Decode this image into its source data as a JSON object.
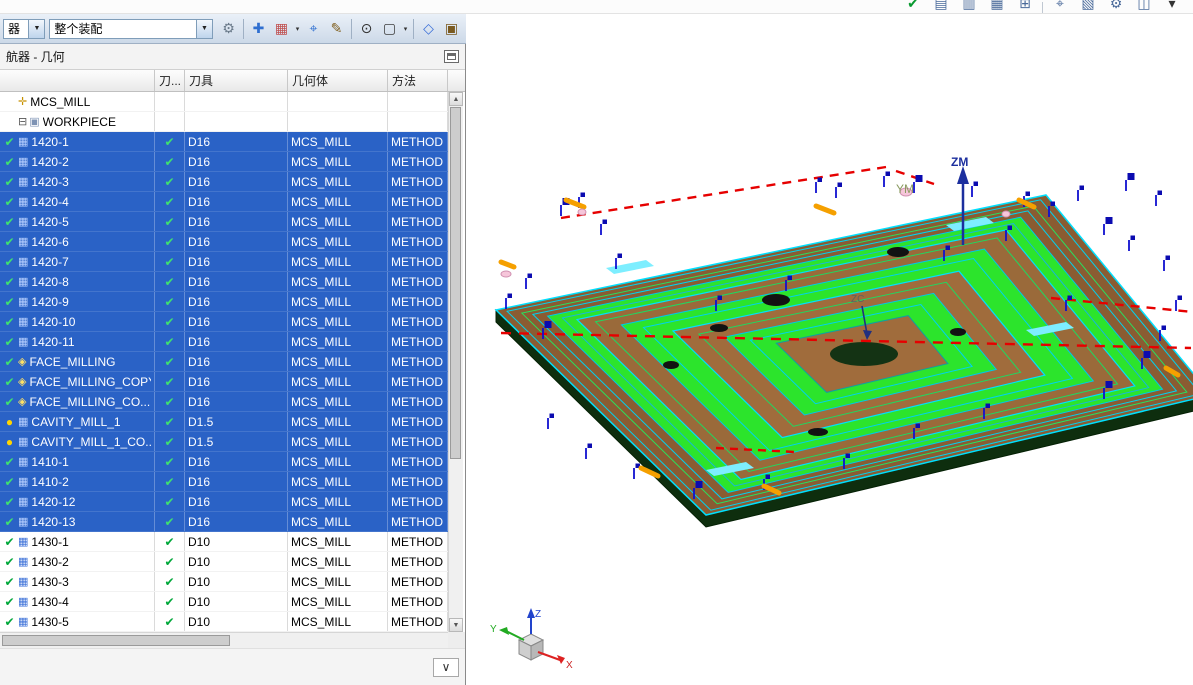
{
  "top_strip": {
    "icons": [
      {
        "name": "finish-icon",
        "glyph": "✔",
        "color": "#0a9a30"
      },
      {
        "name": "maximize-window-icon",
        "glyph": "▤",
        "color": "#4a6a9a"
      },
      {
        "name": "split-view-icon",
        "glyph": "▥",
        "color": "#4a6a9a"
      },
      {
        "name": "window-layout-icon",
        "glyph": "▦",
        "color": "#4a6a9a"
      },
      {
        "name": "new-window-icon",
        "glyph": "⊞",
        "color": "#4a6a9a"
      },
      {
        "sep": true
      },
      {
        "name": "select-filter-icon",
        "glyph": "⌖",
        "color": "#4a6a9a"
      },
      {
        "name": "information-icon",
        "glyph": "▧",
        "color": "#4a6a9a"
      },
      {
        "name": "customize-icon",
        "glyph": "⚙",
        "color": "#4a6a9a"
      },
      {
        "name": "side-by-side-view-icon",
        "glyph": "◫",
        "color": "#4a6a9a"
      },
      {
        "name": "more-options-icon",
        "glyph": "▾",
        "color": "#333333"
      }
    ]
  },
  "toolbar": {
    "filter_value": "器",
    "assembly_value": "整个装配",
    "icons": [
      {
        "name": "assembly-sequence-icon",
        "glyph": "⚙",
        "color": "#6a7a8a"
      },
      {
        "sep": true
      },
      {
        "name": "add-component-icon",
        "glyph": "✚",
        "color": "#2f6fd0"
      },
      {
        "name": "pattern-component-icon",
        "glyph": "▦",
        "color": "#c05050",
        "dropdown": true
      },
      {
        "name": "move-component-icon",
        "glyph": "⌖",
        "color": "#2f6fd0"
      },
      {
        "name": "assembly-constraints-icon",
        "glyph": "✎",
        "color": "#806020"
      },
      {
        "sep": true
      },
      {
        "name": "datum-point-icon",
        "glyph": "⊙",
        "color": "#303030"
      },
      {
        "name": "selection-box-icon",
        "glyph": "▢",
        "color": "#404040",
        "dropdown": true
      },
      {
        "sep": true
      },
      {
        "name": "wireframe-view-icon",
        "glyph": "◇",
        "color": "#3a6fd8"
      },
      {
        "name": "shaded-view-icon",
        "glyph": "▣",
        "color": "#7a5a20"
      }
    ]
  },
  "panel": {
    "title": "航器 - 几何",
    "columns": [
      "",
      "刀...",
      "刀具",
      "几何体",
      "方法"
    ],
    "rows": [
      {
        "name": "MCS_MILL",
        "type": "mcs",
        "selected": false,
        "check": false,
        "tool": "",
        "geometry": "",
        "method": ""
      },
      {
        "name": "WORKPIECE",
        "type": "workpiece",
        "selected": false,
        "check": false,
        "tool": "",
        "geometry": "",
        "method": ""
      },
      {
        "name": "1420-1",
        "type": "op",
        "selected": true,
        "check": true,
        "tool": "D16",
        "geometry": "MCS_MILL",
        "method": "METHOD"
      },
      {
        "name": "1420-2",
        "type": "op",
        "selected": true,
        "check": true,
        "tool": "D16",
        "geometry": "MCS_MILL",
        "method": "METHOD"
      },
      {
        "name": "1420-3",
        "type": "op",
        "selected": true,
        "check": true,
        "tool": "D16",
        "geometry": "MCS_MILL",
        "method": "METHOD"
      },
      {
        "name": "1420-4",
        "type": "op",
        "selected": true,
        "check": true,
        "tool": "D16",
        "geometry": "MCS_MILL",
        "method": "METHOD"
      },
      {
        "name": "1420-5",
        "type": "op",
        "selected": true,
        "check": true,
        "tool": "D16",
        "geometry": "MCS_MILL",
        "method": "METHOD"
      },
      {
        "name": "1420-6",
        "type": "op",
        "selected": true,
        "check": true,
        "tool": "D16",
        "geometry": "MCS_MILL",
        "method": "METHOD"
      },
      {
        "name": "1420-7",
        "type": "op",
        "selected": true,
        "check": true,
        "tool": "D16",
        "geometry": "MCS_MILL",
        "method": "METHOD"
      },
      {
        "name": "1420-8",
        "type": "op",
        "selected": true,
        "check": true,
        "tool": "D16",
        "geometry": "MCS_MILL",
        "method": "METHOD"
      },
      {
        "name": "1420-9",
        "type": "op",
        "selected": true,
        "check": true,
        "tool": "D16",
        "geometry": "MCS_MILL",
        "method": "METHOD"
      },
      {
        "name": "1420-10",
        "type": "op",
        "selected": true,
        "check": true,
        "tool": "D16",
        "geometry": "MCS_MILL",
        "method": "METHOD"
      },
      {
        "name": "1420-11",
        "type": "op",
        "selected": true,
        "check": true,
        "tool": "D16",
        "geometry": "MCS_MILL",
        "method": "METHOD"
      },
      {
        "name": "FACE_MILLING",
        "type": "face",
        "selected": true,
        "check": true,
        "tool": "D16",
        "geometry": "MCS_MILL",
        "method": "METHOD"
      },
      {
        "name": "FACE_MILLING_COPY",
        "type": "face",
        "selected": true,
        "check": true,
        "tool": "D16",
        "geometry": "MCS_MILL",
        "method": "METHOD"
      },
      {
        "name": "FACE_MILLING_CO...",
        "type": "face",
        "selected": true,
        "check": true,
        "tool": "D16",
        "geometry": "MCS_MILL",
        "method": "METHOD"
      },
      {
        "name": "CAVITY_MILL_1",
        "type": "cavity",
        "selected": true,
        "check": true,
        "tool": "D1.5",
        "geometry": "MCS_MILL",
        "method": "METHOD"
      },
      {
        "name": "CAVITY_MILL_1_CO...",
        "type": "cavity",
        "selected": true,
        "check": true,
        "tool": "D1.5",
        "geometry": "MCS_MILL",
        "method": "METHOD"
      },
      {
        "name": "1410-1",
        "type": "op",
        "selected": true,
        "check": true,
        "tool": "D16",
        "geometry": "MCS_MILL",
        "method": "METHOD"
      },
      {
        "name": "1410-2",
        "type": "op",
        "selected": true,
        "check": true,
        "tool": "D16",
        "geometry": "MCS_MILL",
        "method": "METHOD"
      },
      {
        "name": "1420-12",
        "type": "op",
        "selected": true,
        "check": true,
        "tool": "D16",
        "geometry": "MCS_MILL",
        "method": "METHOD"
      },
      {
        "name": "1420-13",
        "type": "op",
        "selected": true,
        "check": true,
        "tool": "D16",
        "geometry": "MCS_MILL",
        "method": "METHOD"
      },
      {
        "name": "1430-1",
        "type": "op",
        "selected": false,
        "check": true,
        "tool": "D10",
        "geometry": "MCS_MILL",
        "method": "METHOD"
      },
      {
        "name": "1430-2",
        "type": "op",
        "selected": false,
        "check": true,
        "tool": "D10",
        "geometry": "MCS_MILL",
        "method": "METHOD"
      },
      {
        "name": "1430-3",
        "type": "op",
        "selected": false,
        "check": true,
        "tool": "D10",
        "geometry": "MCS_MILL",
        "method": "METHOD"
      },
      {
        "name": "1430-4",
        "type": "op",
        "selected": false,
        "check": true,
        "tool": "D10",
        "geometry": "MCS_MILL",
        "method": "METHOD"
      },
      {
        "name": "1430-5",
        "type": "op",
        "selected": false,
        "check": true,
        "tool": "D10",
        "geometry": "MCS_MILL",
        "method": "METHOD"
      }
    ]
  },
  "viewport": {
    "labels": {
      "zm": "ZM",
      "ym": "YM",
      "zc": "ZC"
    },
    "triad": {
      "x": "X",
      "y": "Y",
      "z": "Z"
    }
  },
  "colors": {
    "selection_blue": "#2a62c6",
    "check_green": "#00a83a",
    "toolpath_cyan": "#00e0ff",
    "pocket_green": "#2ce42c",
    "stock_brown": "#8a5c32",
    "warning_red": "#e60000",
    "marker_blue": "#1010d0"
  },
  "ui": {
    "check": "✔",
    "bulb": "●",
    "expander": "⊟",
    "scroll_up": "▲",
    "scroll_down": "▼",
    "expand": "∨",
    "combo_arrow": "▼"
  }
}
